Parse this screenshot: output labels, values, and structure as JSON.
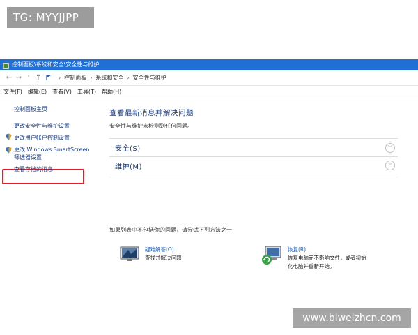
{
  "badge": {
    "text": "TG: MYYJJPP"
  },
  "window": {
    "title": "控制面板\\系统和安全\\安全性与维护"
  },
  "addressbar": {
    "crumbs": [
      "控制面板",
      "系统和安全",
      "安全性与维护"
    ]
  },
  "menu": {
    "items": [
      "文件(F)",
      "编辑(E)",
      "查看(V)",
      "工具(T)",
      "帮助(H)"
    ]
  },
  "sidebar": {
    "home": "控制面板主页",
    "security_settings": "更改安全性与维护设置",
    "uac_settings": "更改用户帐户控制设置",
    "smartscreen_line1": "更改 Windows SmartScreen",
    "smartscreen_line2": "筛选器设置",
    "archived": "查看存档的消息"
  },
  "main": {
    "title": "查看最新消息并解决问题",
    "subtitle": "安全性与维护未检测到任何问题。",
    "sections": [
      {
        "label": "安全(S)"
      },
      {
        "label": "维护(M)"
      }
    ],
    "prompt": "如果列表中不包括你的问题，请尝试下列方法之一:",
    "tools": [
      {
        "link": "疑难解答(O)",
        "desc": "查找并解决问题"
      },
      {
        "link": "恢复(R)",
        "desc_line1": "恢复电脑而不影响文件，或者初始",
        "desc_line2": "化电脑并重新开始。"
      }
    ]
  },
  "watermark": {
    "text": "www.biweizhcn.com"
  },
  "colors": {
    "titlebar": "#1f6fd6",
    "link": "#1a3e86",
    "highlight": "#e01e2c"
  }
}
